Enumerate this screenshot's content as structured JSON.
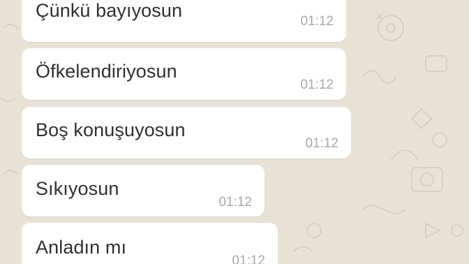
{
  "chat": {
    "background_color": "#e8e2d6",
    "bubble_color": "#ffffff",
    "messages": [
      {
        "text": "Çünkü bayıyosun",
        "time": "01:12"
      },
      {
        "text": "Öfkelendiriyosun",
        "time": "01:12"
      },
      {
        "text": "Boş konuşuyosun",
        "time": "01:12"
      },
      {
        "text": "Sıkıyosun",
        "time": "01:12"
      },
      {
        "text": "Anladın mı",
        "time": "01:12"
      }
    ]
  }
}
